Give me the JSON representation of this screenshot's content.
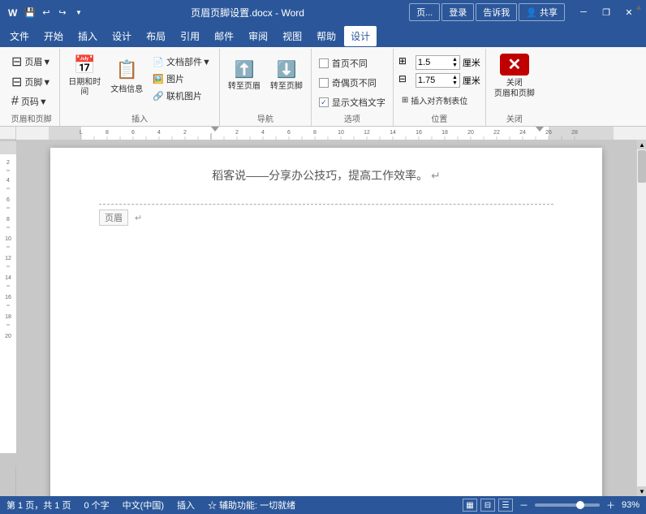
{
  "titleBar": {
    "appName": "Word",
    "fileName": "页眉页脚设置.docx - Word",
    "tabLabel": "页...",
    "loginLabel": "登录",
    "qaLabel": "告诉我",
    "shareLabel": "共享",
    "minimizeIcon": "─",
    "restoreIcon": "❐",
    "closeIcon": "✕"
  },
  "quickAccess": {
    "saveIcon": "💾",
    "undoIcon": "↩",
    "redoIcon": "↪",
    "customizeIcon": "▼"
  },
  "menuBar": {
    "items": [
      "文件",
      "开始",
      "插入",
      "设计",
      "布局",
      "引用",
      "邮件",
      "审阅",
      "视图",
      "帮助",
      "设计"
    ]
  },
  "ribbon": {
    "groups": [
      {
        "name": "页眉和页脚",
        "buttons": [
          {
            "label": "页眉▼",
            "icon": "⊟"
          },
          {
            "label": "页脚▼",
            "icon": "⊟"
          },
          {
            "label": "页码▼",
            "icon": "#"
          }
        ]
      },
      {
        "name": "插入",
        "items": [
          "文档部件▼",
          "图片",
          "联机图片"
        ],
        "dateTimeLabel": "日期和时间",
        "docInfoLabel": "文档信息"
      },
      {
        "name": "导航",
        "navButtons": [
          "转至页眉",
          "转至页脚"
        ]
      },
      {
        "name": "选项",
        "checkboxes": [
          {
            "label": "首页不同",
            "checked": false
          },
          {
            "label": "奇偶页不同",
            "checked": false
          },
          {
            "label": "显示文档文字",
            "checked": true
          }
        ]
      },
      {
        "name": "位置",
        "topLabel": "1.5 厘米",
        "bottomLabel": "1.75 厘米",
        "unitLabel": "厘米"
      },
      {
        "name": "关闭",
        "closeLabel": "关闭\n页眉和页脚"
      }
    ]
  },
  "document": {
    "headerText": "页眉",
    "bodyText": "稻客说——分享办公技巧，提高工作效率。",
    "returnChar": "↵"
  },
  "statusBar": {
    "page": "第 1 页，共 1 页",
    "wordCount": "0 个字",
    "language": "中文(中国)",
    "inputMode": "插入",
    "accessibility": "☆ 辅助功能: 一切就绪",
    "zoom": "93%"
  }
}
